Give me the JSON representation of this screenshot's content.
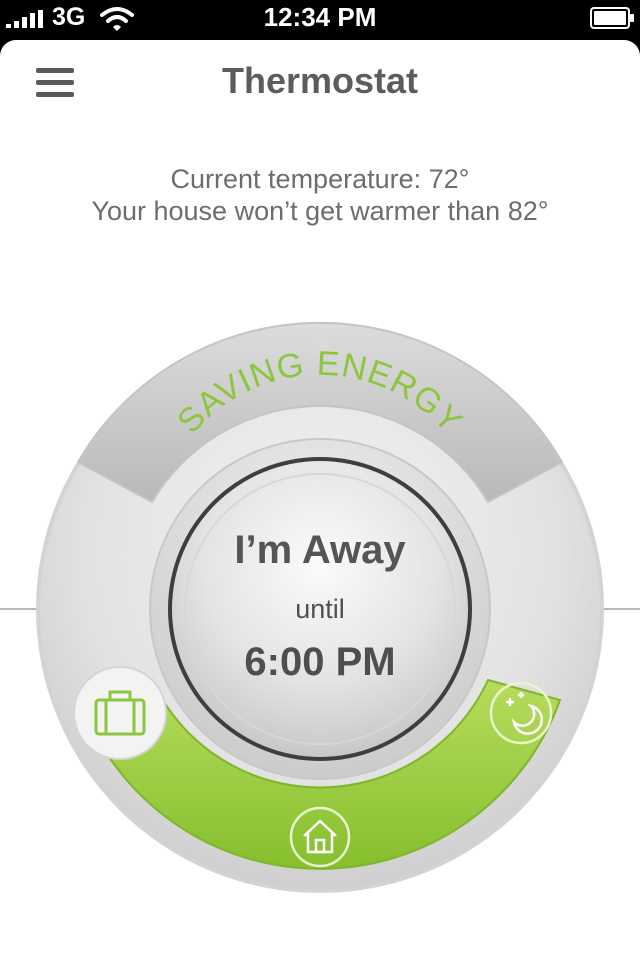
{
  "status_bar": {
    "carrier": "3G",
    "time": "12:34 PM",
    "icons": [
      "signal-bars-icon",
      "wifi-icon",
      "battery-icon"
    ]
  },
  "nav": {
    "title": "Thermostat",
    "menu_icon": "hamburger-menu-icon"
  },
  "info": {
    "current_temperature": "Current temperature: 72°",
    "max_temperature": "Your house won’t get warmer than 82°"
  },
  "dial": {
    "mode_label": "SAVING ENERGY",
    "status": "I’m Away",
    "until_label": "until",
    "until_time": "6:00 PM",
    "modes": [
      {
        "name": "away",
        "icon": "suitcase-icon",
        "active": true
      },
      {
        "name": "home",
        "icon": "home-icon",
        "active": false
      },
      {
        "name": "night",
        "icon": "moon-stars-icon",
        "active": false
      }
    ]
  },
  "colors": {
    "accent_green": "#8cc63f",
    "text_gray": "#5c5c5c",
    "background": "#ffffff"
  }
}
